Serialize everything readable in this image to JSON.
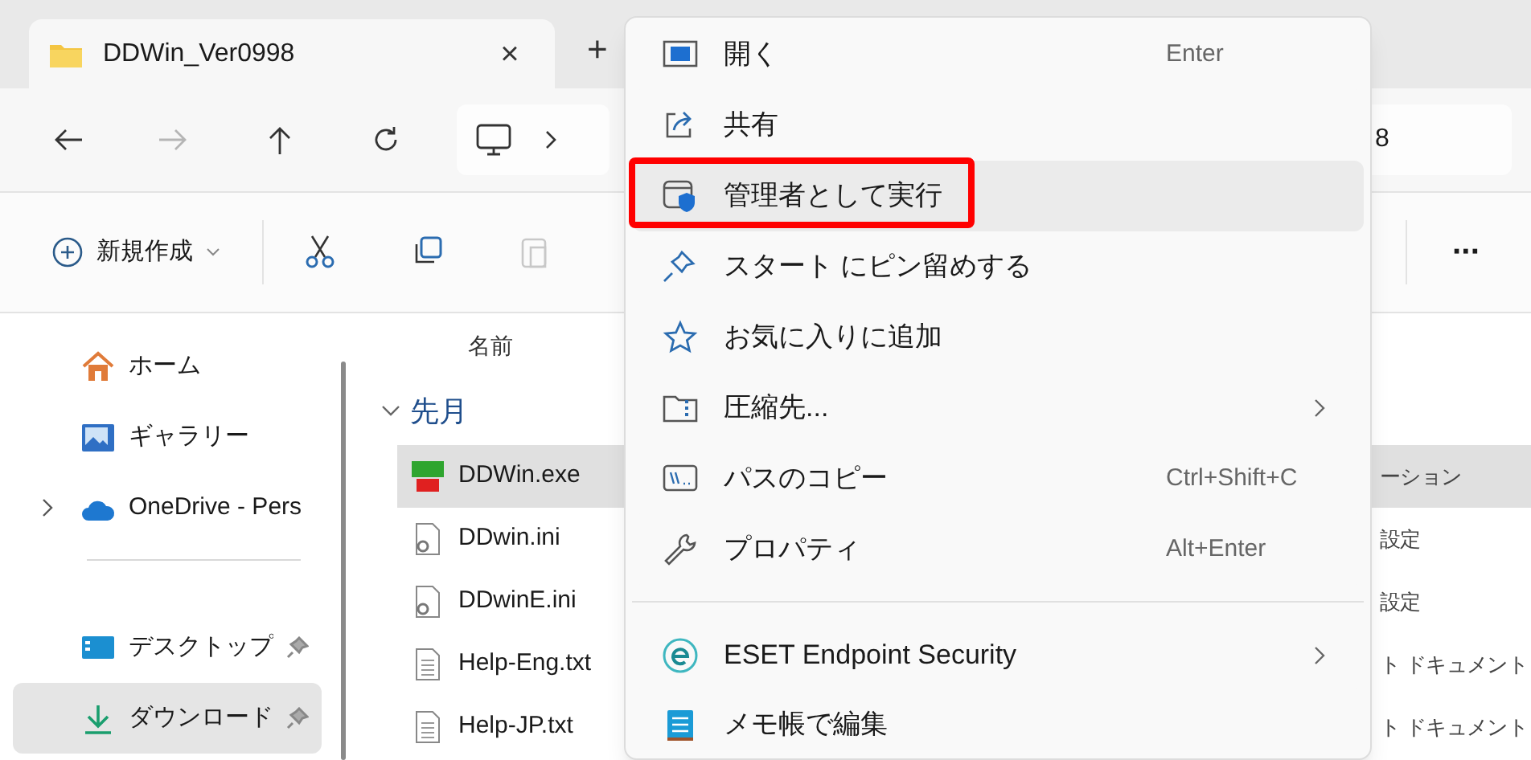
{
  "tab": {
    "title": "DDWin_Ver0998",
    "close": "×",
    "new_tab": "+"
  },
  "nav": {
    "buttons": [
      {
        "disabled": false
      },
      {
        "disabled": true
      },
      {
        "disabled": false
      },
      {
        "disabled": false
      }
    ],
    "address_end": "8"
  },
  "toolbar": {
    "new_label": "新規作成",
    "buttons": [
      {
        "disabled": false
      },
      {
        "disabled": false
      },
      {
        "disabled": true
      }
    ],
    "more": "···"
  },
  "sidebar": {
    "items": [
      {
        "label": "ホーム",
        "expandable": false,
        "pinned": false,
        "selected": false,
        "divider_before": false
      },
      {
        "label": "ギャラリー",
        "expandable": false,
        "pinned": false,
        "selected": false,
        "divider_before": false
      },
      {
        "label": "OneDrive - Pers",
        "expandable": true,
        "pinned": false,
        "selected": false,
        "divider_before": false
      },
      {
        "label": "デスクトップ",
        "expandable": false,
        "pinned": true,
        "selected": false,
        "divider_before": true
      },
      {
        "label": "ダウンロード",
        "expandable": false,
        "pinned": true,
        "selected": true,
        "divider_before": false
      }
    ]
  },
  "files": {
    "column": "名前",
    "group": {
      "label": "先月",
      "expanded": true
    },
    "rows": [
      {
        "kind": "exe",
        "name": "DDWin.exe",
        "type": "ーション",
        "selected": true
      },
      {
        "kind": "ini",
        "name": "DDwin.ini",
        "type": "設定",
        "selected": false
      },
      {
        "kind": "ini",
        "name": "DDwinE.ini",
        "type": "設定",
        "selected": false
      },
      {
        "kind": "txt",
        "name": "Help-Eng.txt",
        "type": "ト ドキュメント",
        "selected": false
      },
      {
        "kind": "txt",
        "name": "Help-JP.txt",
        "type": "ト ドキュメント",
        "selected": false
      }
    ]
  },
  "context_menu": {
    "items": [
      {
        "label": "開く",
        "shortcut": "Enter",
        "submenu": false,
        "hovered": false,
        "annotated": false,
        "divider_before": false
      },
      {
        "label": "共有",
        "submenu": false,
        "hovered": false,
        "annotated": false,
        "divider_before": false
      },
      {
        "label": "管理者として実行",
        "submenu": false,
        "hovered": true,
        "annotated": true,
        "divider_before": false
      },
      {
        "label": "スタート にピン留めする",
        "submenu": false,
        "hovered": false,
        "annotated": false,
        "divider_before": false
      },
      {
        "label": "お気に入りに追加",
        "submenu": false,
        "hovered": false,
        "annotated": false,
        "divider_before": false
      },
      {
        "label": "圧縮先...",
        "submenu": true,
        "hovered": false,
        "annotated": false,
        "divider_before": false
      },
      {
        "label": "パスのコピー",
        "shortcut": "Ctrl+Shift+C",
        "submenu": false,
        "hovered": false,
        "annotated": false,
        "divider_before": false
      },
      {
        "label": "プロパティ",
        "shortcut": "Alt+Enter",
        "submenu": false,
        "hovered": false,
        "annotated": false,
        "divider_before": false
      },
      {
        "label": "ESET Endpoint Security",
        "submenu": true,
        "hovered": false,
        "annotated": false,
        "divider_before": true
      },
      {
        "label": "メモ帳で編集",
        "submenu": false,
        "hovered": false,
        "annotated": false,
        "divider_before": false
      }
    ]
  }
}
